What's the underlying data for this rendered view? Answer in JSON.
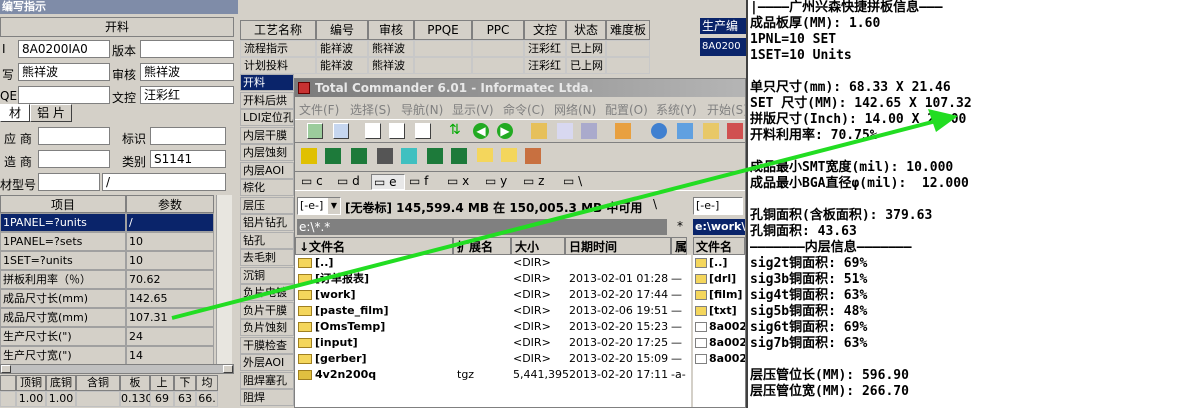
{
  "left": {
    "title": "编写指示",
    "section_header": "开料",
    "fields": {
      "id_value": "8A0200IA0",
      "version_label": "版本",
      "writer_label": "写",
      "writer_value": "熊祥波",
      "reviewer_label": "审核",
      "reviewer_value": "熊祥波",
      "pqe_label": "QE",
      "proof_label": "文控",
      "proof_value": "汪彩红"
    },
    "tabs": [
      "材",
      "铝 片"
    ],
    "supplier_label": "应 商",
    "mark_label": "标识",
    "maker_label": "造 商",
    "category_label": "类别",
    "category_value": "S1141",
    "model_label": "材型号",
    "model_value": "/",
    "table_headers": [
      "项目",
      "参数"
    ],
    "rows": [
      {
        "item": "1PANEL=?units",
        "value": "/"
      },
      {
        "item": "1PANEL=?sets",
        "value": "10"
      },
      {
        "item": "1SET=?units",
        "value": "10"
      },
      {
        "item": "拼板利用率（％）",
        "value": "70.62"
      },
      {
        "item": "成品尺寸长(mm)",
        "value": "142.65"
      },
      {
        "item": "成品尺寸宽(mm)",
        "value": "107.31"
      },
      {
        "item": "生产尺寸长(\")",
        "value": "24"
      },
      {
        "item": "生产尺寸宽(\")",
        "value": "14"
      }
    ],
    "bottom_headers": [
      "顶铜",
      "底铜",
      "含铜mm",
      "板mm",
      "上",
      "下",
      "均"
    ],
    "bottom_values": [
      "1.00",
      "1.00",
      "",
      "0.130",
      "69",
      "63",
      "66."
    ]
  },
  "mid": {
    "headers": [
      "工艺名称",
      "编号",
      "审核",
      "PPQE",
      "PPC",
      "文控",
      "状态",
      "难度板"
    ],
    "rows": [
      [
        "流程指示",
        "能祥波",
        "熊祥波",
        "",
        "",
        "汪彩红",
        "已上网",
        ""
      ],
      [
        "计划投料",
        "能祥波",
        "熊祥波",
        "",
        "",
        "汪彩红",
        "已上网",
        ""
      ]
    ],
    "process_list": [
      "开料",
      "开料后烘",
      "LDI定位孔",
      "内层干膜",
      "内层蚀刻",
      "内层AOI",
      "棕化",
      "层压",
      "铝片钻孔",
      "钻孔",
      "去毛刺",
      "沉铜",
      "负片电镀",
      "负片干膜",
      "负片蚀刻",
      "干膜检查",
      "外层AOI",
      "阻焊塞孔",
      "阻焊"
    ],
    "right_header": "生产编",
    "right_value": "8A0200"
  },
  "tc": {
    "title": "Total Commander 6.01 - Informatec Ltda.",
    "menu": [
      "文件(F)",
      "选择(S)",
      "导航(N)",
      "显示(V)",
      "命令(C)",
      "网络(N)",
      "配置(O)",
      "系统(Y)",
      "开始(S)"
    ],
    "drives": [
      "c",
      "d",
      "e",
      "f",
      "x",
      "y",
      "z",
      "\\"
    ],
    "drive_select": "[-e-]",
    "volume_info": "[无卷标]  145,599.4 MB 在 150,005.3 MB 中可用",
    "path": "e:\\*.*",
    "right_path": "e:\\work\\",
    "right_drive": "[-e-]",
    "cols": [
      "↓文件名",
      "扩展名",
      "大小",
      "日期时间",
      "属"
    ],
    "files": [
      {
        "name": "[..]",
        "ext": "",
        "size": "<DIR>",
        "date": "",
        "attr": ""
      },
      {
        "name": "[订单报表]",
        "ext": "",
        "size": "<DIR>",
        "date": "2013-02-01 01:28",
        "attr": "—"
      },
      {
        "name": "[work]",
        "ext": "",
        "size": "<DIR>",
        "date": "2013-02-20 17:44",
        "attr": "—"
      },
      {
        "name": "[paste_film]",
        "ext": "",
        "size": "<DIR>",
        "date": "2013-02-06 19:51",
        "attr": "—"
      },
      {
        "name": "[OmsTemp]",
        "ext": "",
        "size": "<DIR>",
        "date": "2013-02-20 15:23",
        "attr": "—"
      },
      {
        "name": "[input]",
        "ext": "",
        "size": "<DIR>",
        "date": "2013-02-20 17:25",
        "attr": "—"
      },
      {
        "name": "[gerber]",
        "ext": "",
        "size": "<DIR>",
        "date": "2013-02-20 15:09",
        "attr": "—"
      },
      {
        "name": "4v2n200q",
        "ext": "tgz",
        "size": "5,441,395",
        "date": "2013-02-20 17:11",
        "attr": "-a-"
      }
    ],
    "right_col": "文件名",
    "right_files": [
      "[..]",
      "[drl]",
      "[film]",
      "[txt]",
      "8a002",
      "8a002",
      "8a002"
    ]
  },
  "info": {
    "lines": [
      "|————广州兴森快捷拼板信息———",
      "成品板厚(MM): 1.60",
      "1PNL=10 SET",
      "1SET=10 Units",
      "",
      "单只尺寸(mm): 68.33 X 21.46",
      "SET 尺寸(MM): 142.65 X 107.32",
      "拼版尺寸(Inch): 14.00 X 24.00",
      "开料利用率: 70.75%",
      "",
      "成品最小SMT宽度(mil): 10.000",
      "成品最小BGA直径φ(mil):  12.000",
      "",
      "孔铜面积(含板面积): 379.63",
      "孔铜面积: 43.63",
      "———————内层信息———————",
      "sig2t铜面积: 69%",
      "sig3b铜面积: 51%",
      "sig4t铜面积: 63%",
      "sig5b铜面积: 48%",
      "sig6t铜面积: 69%",
      "sig7b铜面积: 63%",
      "",
      "层压管位长(MM): 596.90",
      "层压管位宽(MM): 266.70"
    ]
  },
  "colors": {
    "arrow": "#22dd22",
    "titlebar": "#0a246a",
    "selected": "#0a246a",
    "panel": "#d4d0c8"
  }
}
